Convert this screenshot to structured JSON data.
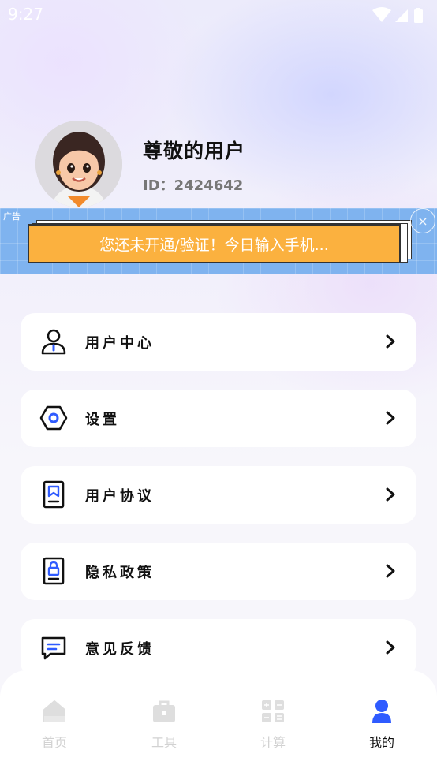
{
  "status_bar": {
    "time": "9:27"
  },
  "profile": {
    "name": "尊敬的用户",
    "id_text": "ID：2424642"
  },
  "ad": {
    "tag": "广告",
    "message": "您还未开通/验证！今日输入手机...",
    "close_glyph": "×"
  },
  "menu": [
    {
      "label": "用户中心",
      "icon": "user-icon"
    },
    {
      "label": "设置",
      "icon": "settings-hexagon-icon"
    },
    {
      "label": "用户协议",
      "icon": "agreement-document-icon"
    },
    {
      "label": "隐私政策",
      "icon": "privacy-lock-document-icon"
    },
    {
      "label": "意见反馈",
      "icon": "feedback-message-icon"
    }
  ],
  "bottom_nav": [
    {
      "label": "首页",
      "icon": "home-icon",
      "active": false
    },
    {
      "label": "工具",
      "icon": "toolbox-icon",
      "active": false
    },
    {
      "label": "计算",
      "icon": "calculator-icon",
      "active": false
    },
    {
      "label": "我的",
      "icon": "profile-icon",
      "active": true
    }
  ],
  "colors": {
    "accent": "#2f5bff",
    "ad_background": "#7fb3ef",
    "ad_card": "#fbb13f",
    "inactive_nav": "#d2d2d2"
  }
}
